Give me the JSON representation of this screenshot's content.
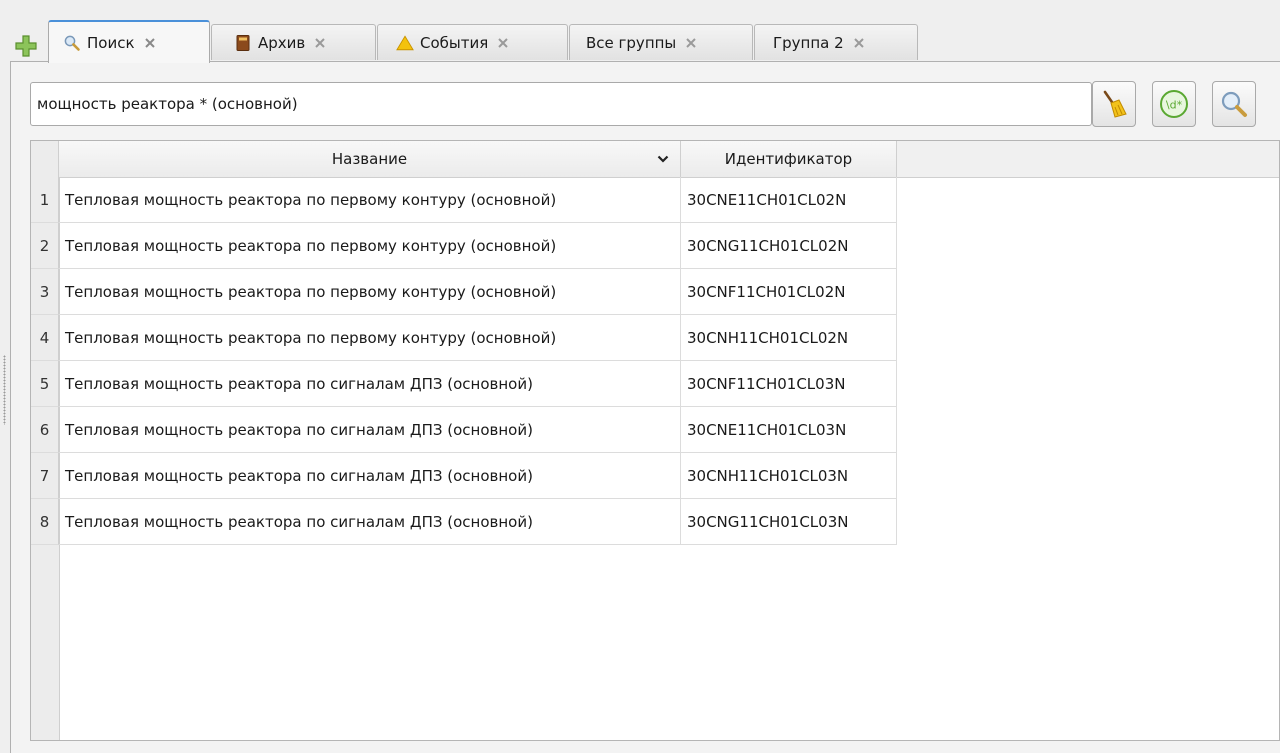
{
  "tabs": [
    {
      "label": "Поиск",
      "icon": "search-icon",
      "active": true
    },
    {
      "label": "Архив",
      "icon": "archive-book-icon",
      "active": false
    },
    {
      "label": "События",
      "icon": "warning-icon",
      "active": false
    },
    {
      "label": "Все группы",
      "icon": "",
      "active": false
    },
    {
      "label": "Группа 2",
      "icon": "",
      "active": false
    }
  ],
  "toolbar": {
    "add_icon": "plus-icon",
    "search_value": "мощность реактора * (основной)",
    "clear_icon": "broom-icon",
    "regex_icon": "regex-icon",
    "regex_glyph": "\\d*",
    "search_icon": "magnifier-icon"
  },
  "table": {
    "columns": [
      "Название",
      "Идентификатор"
    ],
    "rows": [
      {
        "num": "1",
        "name": "Тепловая мощность реактора по первому контуру (основной)",
        "id": "30CNE11CH01CL02N"
      },
      {
        "num": "2",
        "name": "Тепловая мощность реактора по первому контуру (основной)",
        "id": "30CNG11CH01CL02N"
      },
      {
        "num": "3",
        "name": "Тепловая мощность реактора по первому контуру (основной)",
        "id": "30CNF11CH01CL02N"
      },
      {
        "num": "4",
        "name": "Тепловая мощность реактора по первому контуру (основной)",
        "id": "30CNH11CH01CL02N"
      },
      {
        "num": "5",
        "name": "Тепловая мощность реактора по сигналам ДПЗ (основной)",
        "id": "30CNF11CH01CL03N"
      },
      {
        "num": "6",
        "name": "Тепловая мощность реактора по сигналам ДПЗ (основной)",
        "id": "30CNE11CH01CL03N"
      },
      {
        "num": "7",
        "name": "Тепловая мощность реактора по сигналам ДПЗ (основной)",
        "id": "30CNH11CH01CL03N"
      },
      {
        "num": "8",
        "name": "Тепловая мощность реактора по сигналам ДПЗ (основной)",
        "id": "30CNG11CH01CL03N"
      }
    ]
  },
  "colors": {
    "accent": "#4a90d9",
    "add_green": "#6ab04c",
    "warning_yellow": "#f4c20d",
    "archive_brown": "#8b4a1c"
  }
}
